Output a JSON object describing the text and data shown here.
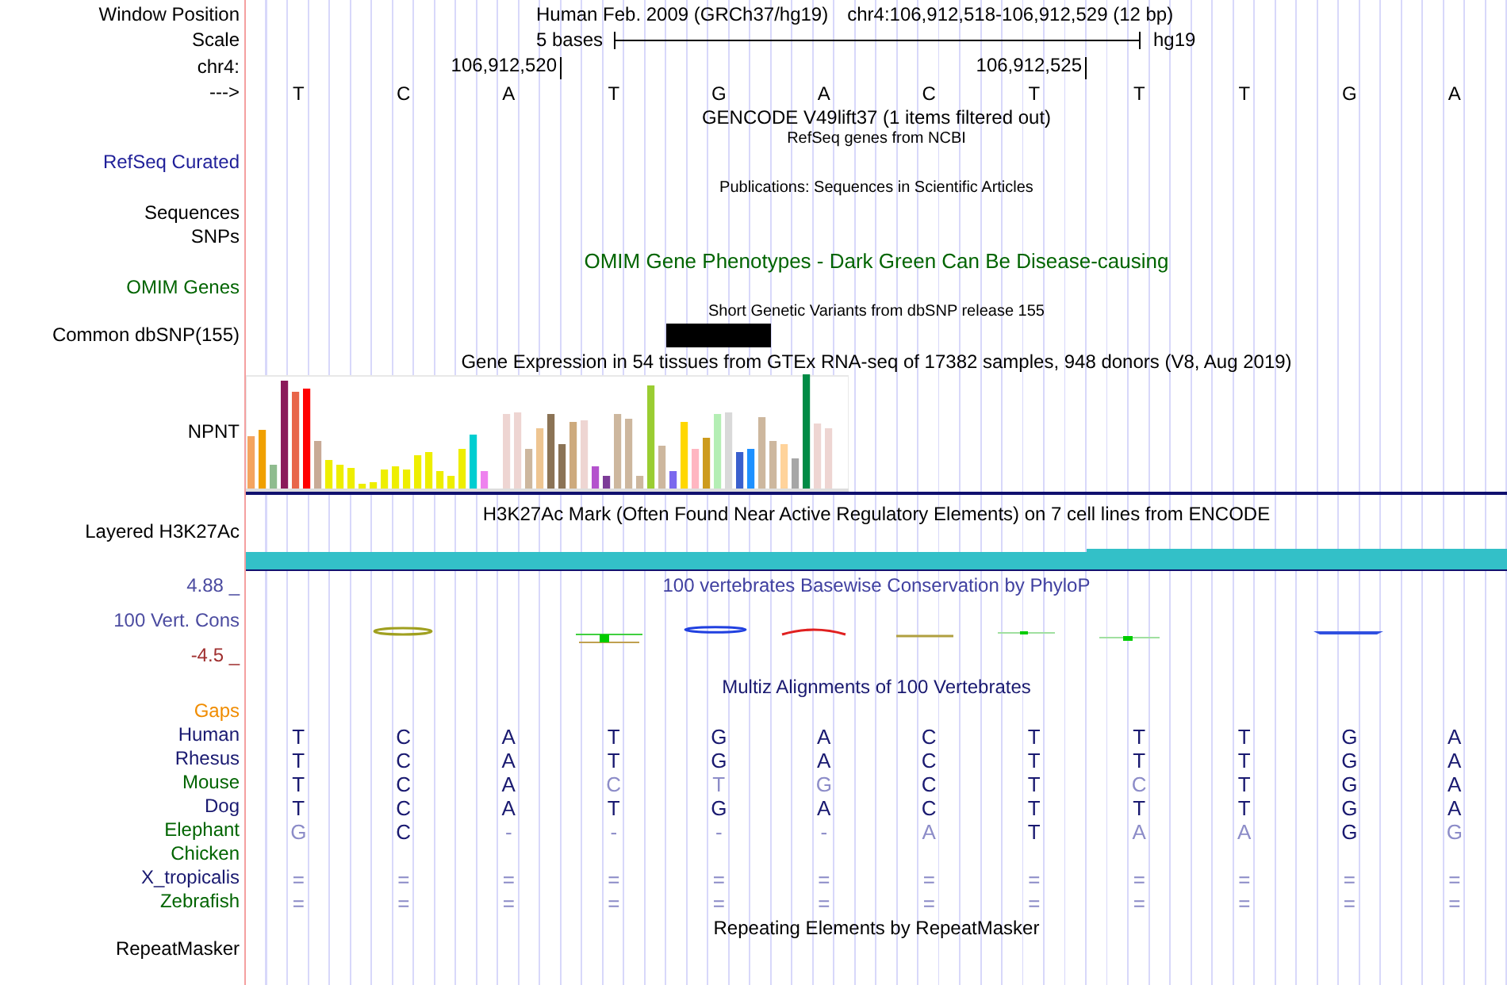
{
  "position": {
    "label": "Window Position",
    "assembly": "Human Feb. 2009 (GRCh37/hg19)",
    "range": "chr4:106,912,518-106,912,529 (12 bp)"
  },
  "scale": {
    "label": "Scale",
    "span": "5 bases",
    "assembly": "hg19"
  },
  "coordinates": {
    "label": "chr4:",
    "ticks": [
      "106,912,520",
      "106,912,525"
    ]
  },
  "strand": {
    "label": "--->",
    "bases": [
      "T",
      "C",
      "A",
      "T",
      "G",
      "A",
      "C",
      "T",
      "T",
      "T",
      "G",
      "A"
    ]
  },
  "gencode": {
    "title": "GENCODE V49lift37 (1 items filtered out)"
  },
  "refseq": {
    "title": "RefSeq genes from NCBI",
    "label": "RefSeq Curated"
  },
  "publications": {
    "title": "Publications: Sequences in Scientific Articles",
    "label": "Sequences"
  },
  "snps": {
    "label": "SNPs"
  },
  "omim": {
    "title": "OMIM Gene Phenotypes - Dark Green Can Be Disease-causing",
    "label": "OMIM Genes"
  },
  "dbsnp": {
    "title": "Short Genetic Variants from dbSNP release 155",
    "label": "Common dbSNP(155)"
  },
  "gtex": {
    "title": "Gene Expression in 54 tissues from GTEx RNA-seq of 17382 samples, 948 donors (V8, Aug 2019)",
    "label": "NPNT"
  },
  "h3k27ac": {
    "title": "H3K27Ac Mark (Often Found Near Active Regulatory Elements) on 7 cell lines from ENCODE",
    "label": "Layered H3K27Ac"
  },
  "phylop": {
    "title": "100 vertebrates Basewise Conservation by PhyloP",
    "label": "100 Vert. Cons",
    "max": "4.88 _",
    "min": "-4.5 _"
  },
  "multiz": {
    "title": "Multiz Alignments of 100 Vertebrates",
    "gaps_label": "Gaps",
    "species": [
      {
        "name": "Human",
        "color": "#191970",
        "bases": [
          {
            "base": "T",
            "faded": false
          },
          {
            "base": "C",
            "faded": false
          },
          {
            "base": "A",
            "faded": false
          },
          {
            "base": "T",
            "faded": false
          },
          {
            "base": "G",
            "faded": false
          },
          {
            "base": "A",
            "faded": false
          },
          {
            "base": "C",
            "faded": false
          },
          {
            "base": "T",
            "faded": false
          },
          {
            "base": "T",
            "faded": false
          },
          {
            "base": "T",
            "faded": false
          },
          {
            "base": "G",
            "faded": false
          },
          {
            "base": "A",
            "faded": false
          }
        ]
      },
      {
        "name": "Rhesus",
        "color": "#191970",
        "bases": [
          {
            "base": "T",
            "faded": false
          },
          {
            "base": "C",
            "faded": false
          },
          {
            "base": "A",
            "faded": false
          },
          {
            "base": "T",
            "faded": false
          },
          {
            "base": "G",
            "faded": false
          },
          {
            "base": "A",
            "faded": false
          },
          {
            "base": "C",
            "faded": false
          },
          {
            "base": "T",
            "faded": false
          },
          {
            "base": "T",
            "faded": false
          },
          {
            "base": "T",
            "faded": false
          },
          {
            "base": "G",
            "faded": false
          },
          {
            "base": "A",
            "faded": false
          }
        ]
      },
      {
        "name": "Mouse",
        "color": "#006400",
        "bases": [
          {
            "base": "T",
            "faded": false
          },
          {
            "base": "C",
            "faded": false
          },
          {
            "base": "A",
            "faded": false
          },
          {
            "base": "C",
            "faded": true
          },
          {
            "base": "T",
            "faded": true
          },
          {
            "base": "G",
            "faded": true
          },
          {
            "base": "C",
            "faded": false
          },
          {
            "base": "T",
            "faded": false
          },
          {
            "base": "C",
            "faded": true
          },
          {
            "base": "T",
            "faded": false
          },
          {
            "base": "G",
            "faded": false
          },
          {
            "base": "A",
            "faded": false
          }
        ]
      },
      {
        "name": "Dog",
        "color": "#191970",
        "bases": [
          {
            "base": "T",
            "faded": false
          },
          {
            "base": "C",
            "faded": false
          },
          {
            "base": "A",
            "faded": false
          },
          {
            "base": "T",
            "faded": false
          },
          {
            "base": "G",
            "faded": false
          },
          {
            "base": "A",
            "faded": false
          },
          {
            "base": "C",
            "faded": false
          },
          {
            "base": "T",
            "faded": false
          },
          {
            "base": "T",
            "faded": false
          },
          {
            "base": "T",
            "faded": false
          },
          {
            "base": "G",
            "faded": false
          },
          {
            "base": "A",
            "faded": false
          }
        ]
      },
      {
        "name": "Elephant",
        "color": "#006400",
        "bases": [
          {
            "base": "G",
            "faded": true
          },
          {
            "base": "C",
            "faded": false
          },
          {
            "base": "-",
            "faded": true
          },
          {
            "base": "-",
            "faded": true
          },
          {
            "base": "-",
            "faded": true
          },
          {
            "base": "-",
            "faded": true
          },
          {
            "base": "A",
            "faded": true
          },
          {
            "base": "T",
            "faded": false
          },
          {
            "base": "A",
            "faded": true
          },
          {
            "base": "A",
            "faded": true
          },
          {
            "base": "G",
            "faded": false
          },
          {
            "base": "G",
            "faded": true
          }
        ]
      },
      {
        "name": "Chicken",
        "color": "#006400"
      },
      {
        "name": "X_tropicalis",
        "color": "#191970",
        "bases": [
          {
            "base": "=",
            "faded": true
          },
          {
            "base": "=",
            "faded": true
          },
          {
            "base": "=",
            "faded": true
          },
          {
            "base": "=",
            "faded": true
          },
          {
            "base": "=",
            "faded": true
          },
          {
            "base": "=",
            "faded": true
          },
          {
            "base": "=",
            "faded": true
          },
          {
            "base": "=",
            "faded": true
          },
          {
            "base": "=",
            "faded": true
          },
          {
            "base": "=",
            "faded": true
          },
          {
            "base": "=",
            "faded": true
          },
          {
            "base": "=",
            "faded": true
          }
        ]
      },
      {
        "name": "Zebrafish",
        "color": "#006400",
        "bases": [
          {
            "base": "=",
            "faded": true
          },
          {
            "base": "=",
            "faded": true
          },
          {
            "base": "=",
            "faded": true
          },
          {
            "base": "=",
            "faded": true
          },
          {
            "base": "=",
            "faded": true
          },
          {
            "base": "=",
            "faded": true
          },
          {
            "base": "=",
            "faded": true
          },
          {
            "base": "=",
            "faded": true
          },
          {
            "base": "=",
            "faded": true
          },
          {
            "base": "=",
            "faded": true
          },
          {
            "base": "=",
            "faded": true
          },
          {
            "base": "=",
            "faded": true
          }
        ]
      }
    ]
  },
  "repeatmasker": {
    "title": "Repeating Elements by RepeatMasker",
    "label": "RepeatMasker"
  }
}
